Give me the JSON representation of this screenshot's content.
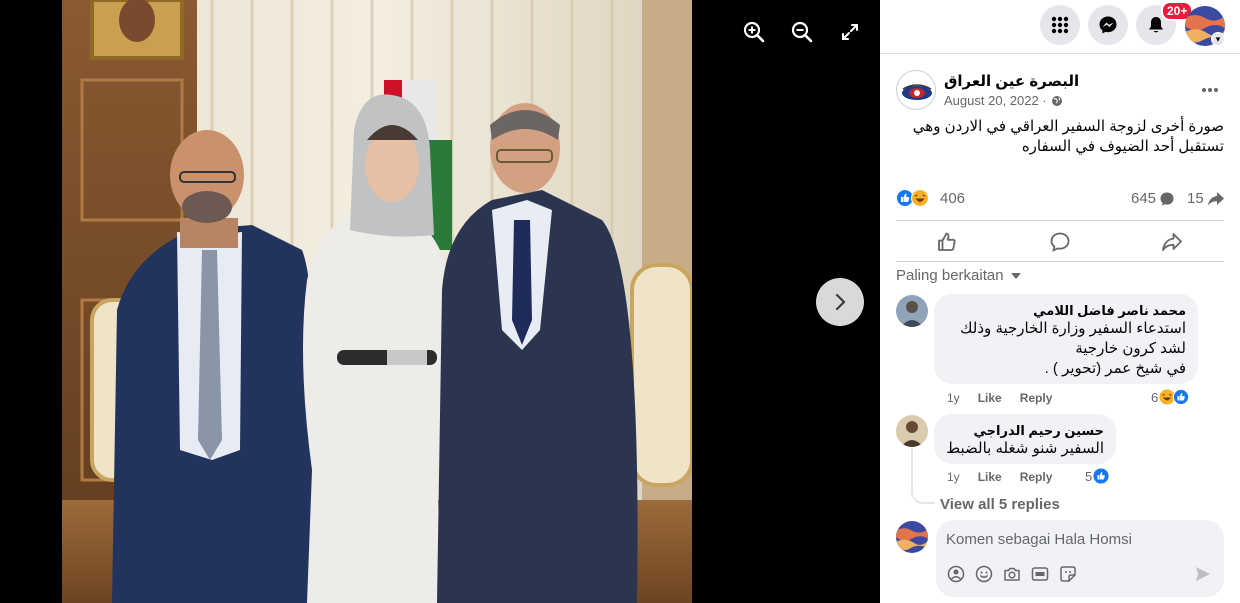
{
  "viewer": {
    "zoom_in_icon": "zoom-in-icon",
    "zoom_out_icon": "zoom-out-icon",
    "fullscreen_icon": "fullscreen-icon",
    "next_icon": "chevron-right-icon"
  },
  "topbar": {
    "notifications_badge": "20+",
    "brand_color": "#1877f2"
  },
  "post": {
    "page_name": "البصرة عين العراق",
    "date": "August 20, 2022 · ",
    "text": "صورة أخرى لزوجة السفير العراقي في الاردن وهي تستقبل أحد الضيوف في السفاره",
    "reaction_count": "406",
    "comment_count": "645",
    "share_count": "15"
  },
  "comments_section": {
    "filter_label": "Paling berkaitan",
    "comments": [
      {
        "author": "محمد ناصر فاضل اللامي",
        "lines": [
          "استدعاء السفير وزارة الخارجية وذلك",
          "لشد كرون خارجية",
          "في شيخ عمر (تحوير ) ."
        ],
        "time": "1y",
        "like_label": "Like",
        "reply_label": "Reply",
        "reactions": "6"
      },
      {
        "author": "حسين رحيم الدراجي",
        "lines": [
          "السفير شنو شغله بالضبط"
        ],
        "time": "1y",
        "like_label": "Like",
        "reply_label": "Reply",
        "reactions": "5"
      }
    ],
    "view_replies": "View all 5 replies"
  },
  "composer": {
    "placeholder": "Komen sebagai Hala Homsi"
  }
}
